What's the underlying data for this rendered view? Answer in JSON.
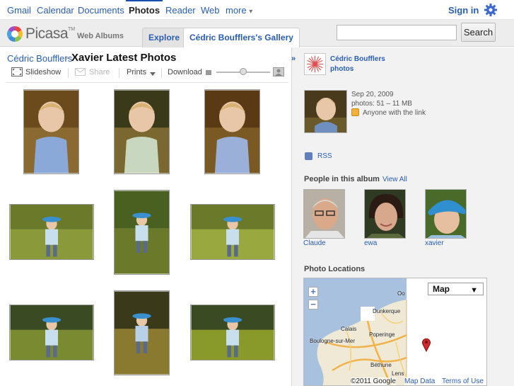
{
  "gbar": {
    "links": [
      "Gmail",
      "Calendar",
      "Documents",
      "Photos",
      "Reader",
      "Web",
      "more"
    ],
    "more_caret": "▾",
    "signin": "Sign in"
  },
  "header": {
    "logo_text": "Picasa",
    "logo_tm": "TM",
    "logo_sub": "Web Albums",
    "tab_explore": "Explore",
    "tab_gallery": "Cédric Boufflers's Gallery",
    "search_value": "",
    "search_button": "Search"
  },
  "album": {
    "breadcrumb_owner": "Cédric Boufflers",
    "breadcrumb_sep": ">",
    "title": "Xavier Latest Photos"
  },
  "toolbar": {
    "slideshow": "Slideshow",
    "share": "Share",
    "prints": "Prints",
    "download": "Download",
    "zoom_level": 0.5
  },
  "photos": [
    {
      "scene": "portrait-smile",
      "orientation": "portrait"
    },
    {
      "scene": "portrait-stand",
      "orientation": "portrait"
    },
    {
      "scene": "portrait-close",
      "orientation": "portrait"
    },
    {
      "scene": "lawn-hat",
      "orientation": "landscape"
    },
    {
      "scene": "lawn-walk",
      "orientation": "portrait"
    },
    {
      "scene": "lawn-hat-2",
      "orientation": "landscape"
    },
    {
      "scene": "park-hat",
      "orientation": "landscape"
    },
    {
      "scene": "park-walk",
      "orientation": "portrait"
    },
    {
      "scene": "park-hat-2",
      "orientation": "landscape"
    }
  ],
  "sidebar": {
    "collapse": "»",
    "owner_name": "Cédric Boufflers",
    "owner_photos": "photos",
    "date": "Sep 20, 2009",
    "stats": "photos: 51 – 11 MB",
    "visibility": "Anyone with the link",
    "rss": "RSS",
    "people_title": "People in this album",
    "view_all": "View All",
    "people": [
      "Claude",
      "ewa",
      "xavier"
    ],
    "locations_title": "Photo Locations"
  },
  "map": {
    "type_label": "Map",
    "type_caret": "▼",
    "zoom_in": "+",
    "zoom_out": "−",
    "places": [
      "Dunkerque",
      "Calais",
      "Poperinge",
      "Boulogne-sur-Mer",
      "Béthune",
      "Lens",
      "Oo"
    ],
    "copyright": "©2011 Google",
    "map_data": "Map Data",
    "terms": "Terms of Use"
  },
  "colors": {
    "link": "#2a5db0",
    "panel_bg": "#f2f2f2",
    "marker": "#d22a2a"
  }
}
